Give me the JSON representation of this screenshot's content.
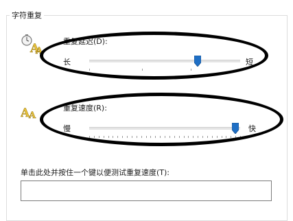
{
  "group": {
    "title": "字符重复"
  },
  "delay": {
    "label": "重复延迟(D):",
    "left": "长",
    "right": "短",
    "level": 0.72
  },
  "rate": {
    "label": "重复速度(R):",
    "left": "慢",
    "right": "快",
    "level": 0.97
  },
  "test": {
    "label": "单击此处并按住一个键以便测试重复速度(T):",
    "value": ""
  },
  "colors": {
    "accent": "#1f6fc5",
    "annotation": "#000000"
  },
  "icons": [
    "keyboard-delay-icon",
    "keyboard-rate-icon"
  ]
}
